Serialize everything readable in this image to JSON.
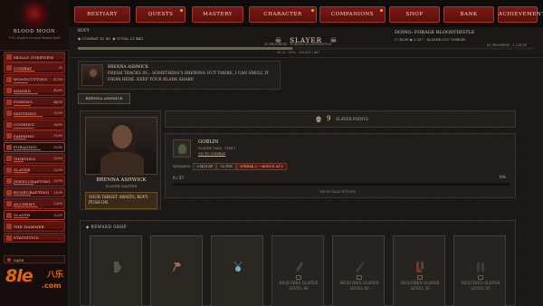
{
  "sidebar": {
    "logo_title": "BLOOD MOON",
    "logo_subtitle": "70% chance to earn bonus loot!",
    "items": [
      {
        "label": "SKILLS OVERVIEW",
        "level": "",
        "progress": 0,
        "active": false
      },
      {
        "label": "COMBAT",
        "level": "39",
        "progress": 0.45,
        "active": false
      },
      {
        "label": "WOODCUTTING",
        "level": "47/99",
        "progress": 0.3,
        "active": false
      },
      {
        "label": "MINING",
        "level": "45/99",
        "progress": 0.5,
        "active": false
      },
      {
        "label": "FISHING",
        "level": "44/99",
        "progress": 0.35,
        "active": false
      },
      {
        "label": "SMITHING",
        "level": "33/99",
        "progress": 0.6,
        "active": false
      },
      {
        "label": "COOKING",
        "level": "38/99",
        "progress": 0.4,
        "active": false
      },
      {
        "label": "FARMING",
        "level": "31/99",
        "progress": 0.25,
        "active": false
      },
      {
        "label": "FORAGING",
        "level": "33/99",
        "progress": 0.55,
        "active": true
      },
      {
        "label": "THIEVING",
        "level": "25/99",
        "progress": 0.2,
        "active": false
      },
      {
        "label": "SLAYER",
        "level": "22/99",
        "progress": 0.3,
        "active": false
      },
      {
        "label": "JEWELCRAFTING",
        "level": "20/99",
        "progress": 0.4,
        "active": false
      },
      {
        "label": "RUNECRAFTING",
        "level": "21/99",
        "progress": 0.35,
        "active": false
      },
      {
        "label": "ALCHEMY",
        "level": "23/99",
        "progress": 0.5,
        "active": false
      },
      {
        "label": "SLAYER",
        "level": "22/99",
        "progress": 0.3,
        "active": true
      },
      {
        "label": "THE HAMMER",
        "level": "",
        "progress": 0,
        "active": false
      },
      {
        "label": "STATISTICS",
        "level": "",
        "progress": 0,
        "active": false
      }
    ],
    "save_label": "SAVE"
  },
  "watermark": {
    "brand": "8le",
    "suffix": "八乐",
    "domain": ".com"
  },
  "topbar": {
    "tabs": [
      {
        "label": "BESTIARY",
        "dot": false
      },
      {
        "label": "QUESTS",
        "dot": true
      },
      {
        "label": "MASTERY",
        "dot": false
      },
      {
        "label": "CHARACTER",
        "dot": true
      },
      {
        "label": "COMPANIONS",
        "dot": true
      },
      {
        "label": "SHOP",
        "dot": false
      },
      {
        "label": "BANK",
        "dot": false
      },
      {
        "label": "ACHIEVEMENTS",
        "dot": false
      }
    ]
  },
  "header": {
    "username": "KOVY",
    "combat_label": "COMBAT LV",
    "combat_value": "30",
    "total_label": "TOTAL LV",
    "total_value": "443",
    "skill_title": "SLAYER",
    "status_text": "IN PROGRESS · FORAGE BLOODTHISTLE",
    "xp_text": "LV 22 · 50% · 203,601 / 467",
    "progress": 0.47,
    "doing_label": "DOING:",
    "doing_value": "FORAGE BLOODTHISTLE",
    "right_stats": "☐ 38/38   ◆ 3,037   · SLAYER 0/37 GOBLIN",
    "right_sub": "IN PROGRESS · 1,234 XP"
  },
  "dialog": {
    "speaker": "BRENNA ASHWICK",
    "text": "FRESH TRACKS IN... SOMETHING'S BREWING OUT THERE, I CAN SMELL IT FROM HERE. KEEP YOUR BLADE SHARP."
  },
  "character_button": "BRENNA ASHWICK",
  "npc": {
    "name": "BRENNA ASHWICK",
    "role": "SLAYER MASTER",
    "message": "YOUR TARGET AWAITS, KOVY. PUSH ON."
  },
  "points": {
    "value": "9",
    "label": "SLAYER POINTS"
  },
  "task": {
    "target": "GOBLIN",
    "subtitle": "SLAYER TASK · TIER I",
    "link": "GO TO COMBAT",
    "rewards_label": "REWARDS",
    "chips": [
      {
        "text": "+1418 XP",
        "style": "plain"
      },
      {
        "text": "+5 PTS",
        "style": "plain"
      },
      {
        "text": "STREAK 2 → BONUS AT 5",
        "style": "red"
      }
    ],
    "progress_text": "0 / 37",
    "percent_text": "0%",
    "progress": 0,
    "more_text": "SHOW TASK OPTIONS"
  },
  "shop": {
    "title": "◆ REWARD SHOP",
    "slots": [
      {
        "icon": "gauntlet-icon",
        "requirement": "",
        "locked": false
      },
      {
        "icon": "axe-icon",
        "requirement": "",
        "locked": false
      },
      {
        "icon": "amulet-icon",
        "requirement": "",
        "locked": false
      },
      {
        "icon": "dagger-icon",
        "requirement": "REQUIRES SLAYER LEVEL 40",
        "locked": true
      },
      {
        "icon": "sword-icon",
        "requirement": "REQUIRES SLAYER LEVEL 60",
        "locked": true
      },
      {
        "icon": "boots-icon",
        "requirement": "REQUIRES SLAYER LEVEL 50",
        "locked": true
      },
      {
        "icon": "bracers-icon",
        "requirement": "REQUIRES SLAYER LEVEL 55",
        "locked": true
      }
    ]
  },
  "colors": {
    "accent_red": "#7a1915",
    "gold_dot": "#e0b040",
    "watermark_orange": "#e06a00"
  }
}
